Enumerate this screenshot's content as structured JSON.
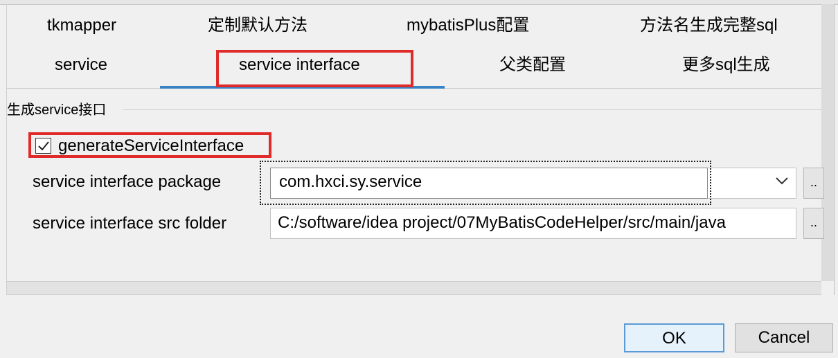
{
  "tabs": {
    "row1": [
      "tkmapper",
      "定制默认方法",
      "mybatisPlus配置",
      "方法名生成完整sql"
    ],
    "row2": [
      "service",
      "service interface",
      "父类配置",
      "更多sql生成"
    ],
    "active": "service interface"
  },
  "group": {
    "title": "生成service接口"
  },
  "checkbox": {
    "label": "generateServiceInterface",
    "checked": true
  },
  "fields": {
    "package_label": "service interface package",
    "package_value": "com.hxci.sy.service",
    "src_folder_label": "service interface src folder",
    "src_folder_value": "C:/software/idea project/07MyBatisCodeHelper/src/main/java",
    "browse_label": ".."
  },
  "buttons": {
    "ok": "OK",
    "cancel": "Cancel"
  },
  "colors": {
    "highlight_red": "#e02b2b",
    "tab_underline": "#3b82c4",
    "ok_border": "#5b9bd5"
  },
  "icons": {
    "checkbox": "checkmark-icon",
    "combo": "chevron-down-icon"
  }
}
